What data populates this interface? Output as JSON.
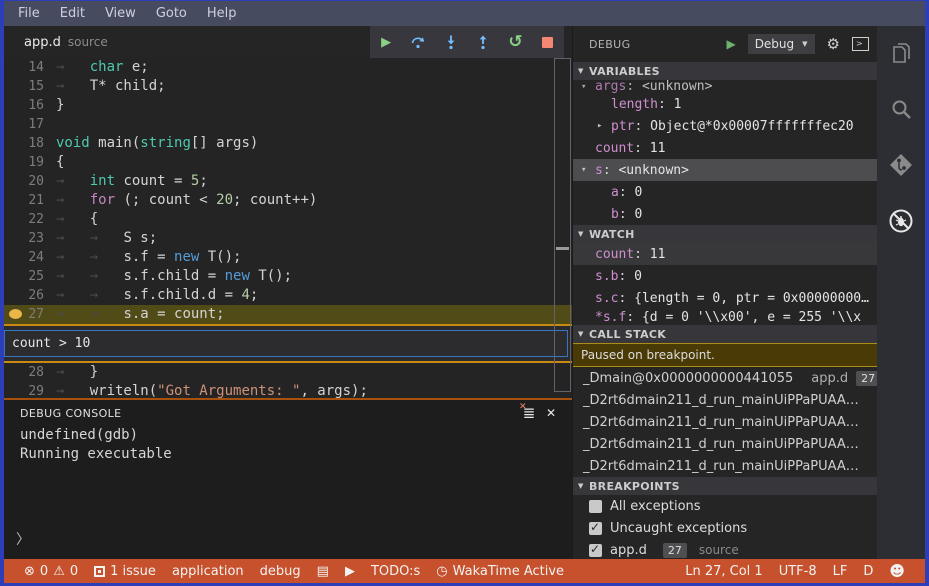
{
  "menu": {
    "items": [
      "File",
      "Edit",
      "View",
      "Goto",
      "Help"
    ]
  },
  "tab": {
    "name": "app.d",
    "type": "source"
  },
  "editor": {
    "lines_top": [
      {
        "num": "14",
        "tokens": [
          [
            "ws",
            "→   "
          ],
          [
            "kw",
            "char"
          ],
          [
            "pl",
            " e;"
          ]
        ]
      },
      {
        "num": "15",
        "tokens": [
          [
            "ws",
            "→   "
          ],
          [
            "pl",
            "T* child;"
          ]
        ]
      },
      {
        "num": "16",
        "tokens": [
          [
            "pl",
            "}"
          ]
        ]
      },
      {
        "num": "17",
        "tokens": []
      },
      {
        "num": "18",
        "tokens": [
          [
            "kw",
            "void"
          ],
          [
            "pl",
            " main("
          ],
          [
            "kw",
            "string"
          ],
          [
            "pl",
            "[] args)"
          ]
        ]
      },
      {
        "num": "19",
        "tokens": [
          [
            "pl",
            "{"
          ]
        ]
      },
      {
        "num": "20",
        "tokens": [
          [
            "ws",
            "→   "
          ],
          [
            "kw",
            "int"
          ],
          [
            "pl",
            " count = "
          ],
          [
            "num",
            "5"
          ],
          [
            "pl",
            ";"
          ]
        ]
      },
      {
        "num": "21",
        "tokens": [
          [
            "ws",
            "→   "
          ],
          [
            "ctl",
            "for"
          ],
          [
            "pl",
            " (; count < "
          ],
          [
            "num",
            "20"
          ],
          [
            "pl",
            "; count++)"
          ]
        ]
      },
      {
        "num": "22",
        "tokens": [
          [
            "ws",
            "→   "
          ],
          [
            "pl",
            "{"
          ]
        ]
      },
      {
        "num": "23",
        "tokens": [
          [
            "ws",
            "→   →   "
          ],
          [
            "pl",
            "S s;"
          ]
        ]
      },
      {
        "num": "24",
        "tokens": [
          [
            "ws",
            "→   →   "
          ],
          [
            "pl",
            "s.f = "
          ],
          [
            "new",
            "new"
          ],
          [
            "pl",
            " T();"
          ]
        ]
      },
      {
        "num": "25",
        "tokens": [
          [
            "ws",
            "→   →   "
          ],
          [
            "pl",
            "s.f.child = "
          ],
          [
            "new",
            "new"
          ],
          [
            "pl",
            " T();"
          ]
        ]
      },
      {
        "num": "26",
        "tokens": [
          [
            "ws",
            "→   →   "
          ],
          [
            "pl",
            "s.f.child.d = "
          ],
          [
            "num",
            "4"
          ],
          [
            "pl",
            ";"
          ]
        ]
      },
      {
        "num": "27",
        "bp": true,
        "active": true,
        "tokens": [
          [
            "ws",
            "→   →   "
          ],
          [
            "pl",
            "s.a = count;"
          ]
        ]
      }
    ],
    "condition": "count > 10",
    "lines_bottom": [
      {
        "num": "28",
        "tokens": [
          [
            "ws",
            "→   "
          ],
          [
            "pl",
            "}"
          ]
        ]
      },
      {
        "num": "29",
        "tokens": [
          [
            "ws",
            "→   "
          ],
          [
            "pl",
            "writeln("
          ],
          [
            "str",
            "\"Got Arguments: \""
          ],
          [
            "pl",
            ", args);"
          ]
        ]
      }
    ]
  },
  "debug_panel": {
    "title": "DEBUG",
    "config": "Debug"
  },
  "sections": {
    "variables": "VARIABLES",
    "watch": "WATCH",
    "call_stack": "CALL STACK",
    "breakpoints": "BREAKPOINTS"
  },
  "variables": {
    "rows": [
      {
        "expander": "▾",
        "name": "args",
        "value": "<unknown>",
        "clipped": true
      },
      {
        "expander": "",
        "name": "length",
        "value": "1",
        "child": true
      },
      {
        "expander": "▸",
        "name": "ptr",
        "value": "Object@*0x00007fffffffec20",
        "child": true
      },
      {
        "expander": "",
        "name": "count",
        "value": "11"
      },
      {
        "expander": "▾",
        "name": "s",
        "value": "<unknown>",
        "selected": true
      },
      {
        "expander": "",
        "name": "a",
        "value": "0",
        "child": true
      },
      {
        "expander": "",
        "name": "b",
        "value": "0",
        "child": true
      }
    ]
  },
  "watch": {
    "rows": [
      {
        "name": "count",
        "value": "11",
        "selected": true
      },
      {
        "name": "s.b",
        "value": "0"
      },
      {
        "name": "s.c",
        "value": "{length = 0, ptr = 0x00000000…"
      },
      {
        "name": "*s.f",
        "value": "{d = 0 '\\\\x00', e = 255 '\\\\x",
        "clipped": true
      }
    ]
  },
  "call_stack": {
    "message": "Paused on breakpoint.",
    "frames": [
      {
        "name": "_Dmain@0x0000000000441055",
        "file": "app.d",
        "badge": "27"
      },
      {
        "name": "_D2rt6dmain211_d_run_mainUiPPaPUAA…"
      },
      {
        "name": "_D2rt6dmain211_d_run_mainUiPPaPUAA…"
      },
      {
        "name": "_D2rt6dmain211_d_run_mainUiPPaPUAA…"
      },
      {
        "name": "_D2rt6dmain211_d_run_mainUiPPaPUAA…"
      }
    ]
  },
  "breakpoints": {
    "rows": [
      {
        "checked": false,
        "label": "All exceptions"
      },
      {
        "checked": true,
        "label": "Uncaught exceptions"
      },
      {
        "checked": true,
        "label": "app.d",
        "badge": "27",
        "hint": "source"
      }
    ]
  },
  "console": {
    "title": "DEBUG CONSOLE",
    "lines": [
      "undefined(gdb)",
      "Running executable"
    ],
    "prompt": "〉"
  },
  "status": {
    "errors": "0",
    "warnings": "0",
    "issues": "1 issue",
    "task": "application",
    "mode": "debug",
    "todo": "TODO:s",
    "waka": "WakaTime Active",
    "position": "Ln 27, Col 1",
    "encoding": "UTF-8",
    "eol": "LF",
    "language": "D"
  },
  "activity_bar": {
    "icons": [
      "files-icon",
      "search-icon",
      "git-icon",
      "debug-icon"
    ],
    "active": "debug-icon"
  },
  "colors": {
    "window_border": "#2e3eb8",
    "menubar": "#474b60",
    "statusbar": "#c6512c",
    "current_line": "#514b17",
    "condition_border": "#c98a12",
    "breakpoint_dot": "#eab648",
    "play_green": "#89d185",
    "stop_red": "#f48771",
    "step_blue": "#75beff",
    "variable_name": "#cf8fcf",
    "keyword_teal": "#4ec9b0",
    "keyword_pink": "#c586c0",
    "keyword_blue": "#569cd6",
    "number_green": "#b5cea8",
    "string_orange": "#ce9178"
  }
}
